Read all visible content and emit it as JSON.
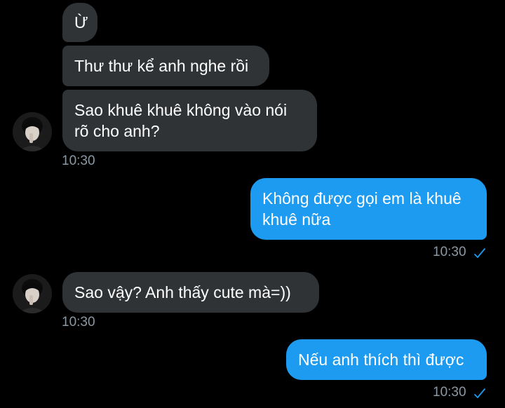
{
  "colors": {
    "background": "#000000",
    "incoming_bubble": "#2f3336",
    "outgoing_bubble": "#1d9bf0",
    "timestamp": "#8b98a5",
    "read_check": "#1d9bf0"
  },
  "messages": [
    {
      "direction": "incoming",
      "text": "Ừ"
    },
    {
      "direction": "incoming",
      "text": "Thư thư kể anh nghe rồi"
    },
    {
      "direction": "incoming",
      "lines": [
        "Sao khuê khuê không vào nói",
        "rõ cho anh?"
      ],
      "time": "10:30"
    },
    {
      "direction": "outgoing",
      "lines": [
        "Không được gọi em là khuê",
        "khuê nữa"
      ],
      "time": "10:30",
      "status_icon": "double-check-icon"
    },
    {
      "direction": "incoming",
      "text": "Sao vậy? Anh thấy cute mà=))",
      "time": "10:30"
    },
    {
      "direction": "outgoing",
      "text": "Nếu anh thích thì được",
      "time": "10:30",
      "status_icon": "double-check-icon"
    }
  ],
  "avatar_icon": "user-avatar-icon"
}
